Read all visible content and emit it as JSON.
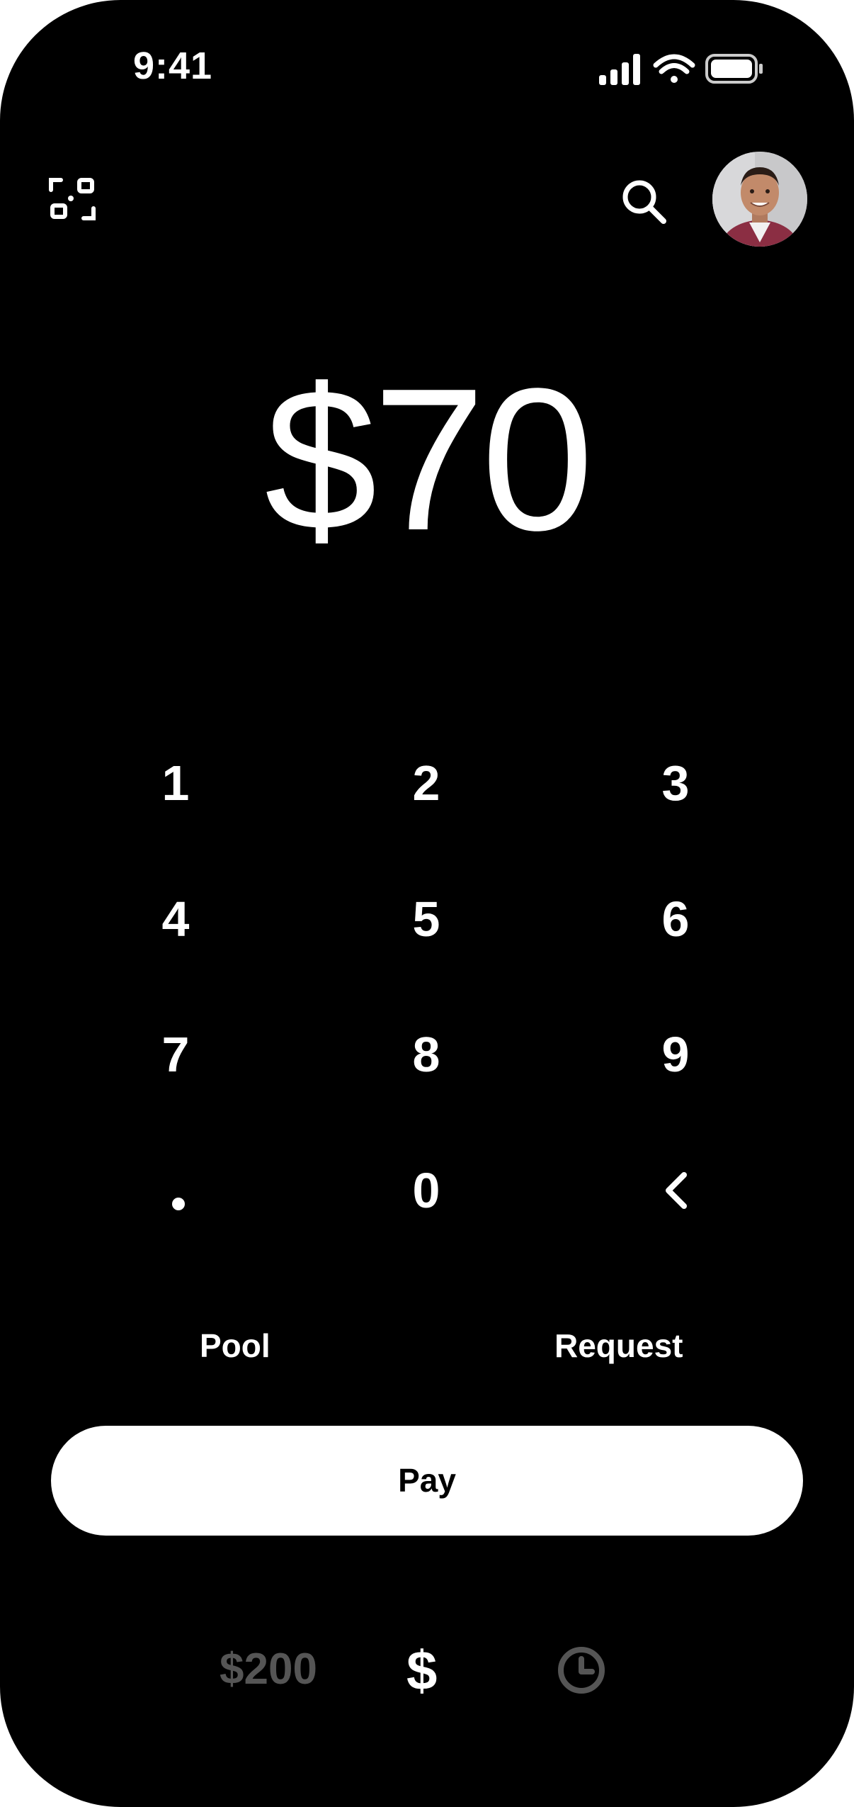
{
  "status_bar": {
    "time": "9:41"
  },
  "amount": {
    "value": "$70"
  },
  "keypad": {
    "keys": [
      "1",
      "2",
      "3",
      "4",
      "5",
      "6",
      "7",
      "8",
      "9",
      ".",
      "0",
      "<"
    ]
  },
  "actions": {
    "pool_label": "Pool",
    "request_label": "Request"
  },
  "pay_button": {
    "label": "Pay"
  },
  "bottom_nav": {
    "balance": "$200",
    "money_tab": "$"
  },
  "colors": {
    "background": "#000000",
    "foreground": "#ffffff",
    "muted": "#555555"
  },
  "icons": [
    "signal-icon",
    "wifi-icon",
    "battery-icon",
    "qr-scan-icon",
    "search-icon",
    "avatar",
    "backspace-icon",
    "clock-icon"
  ]
}
